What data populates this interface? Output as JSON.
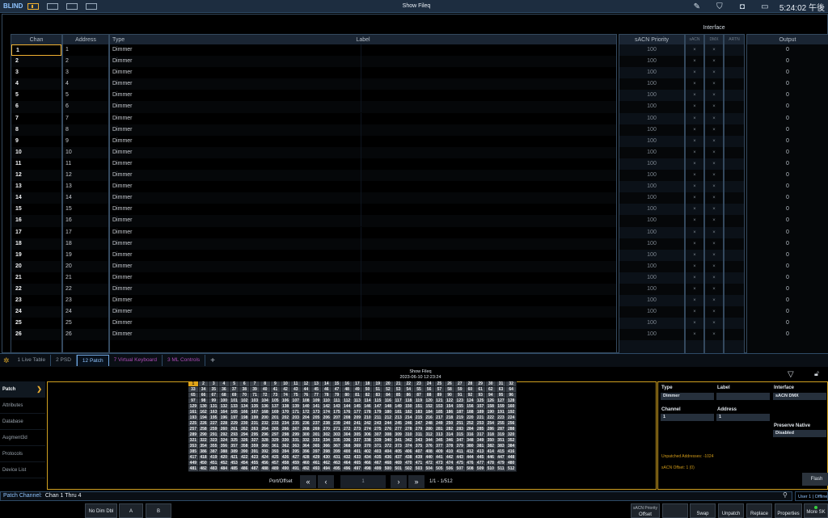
{
  "topbar": {
    "mode": "BLIND",
    "show_title": "Show Fileq",
    "clock": "5:24:02 午後"
  },
  "table": {
    "interface_title": "Interface",
    "headers": {
      "chan": "Chan",
      "address": "Address",
      "type": "Type",
      "label": "Label",
      "sacn_priority": "sACN Priority",
      "sacn": "sACN",
      "dmx": "DMX",
      "artnet": "ARTN",
      "output": "Output"
    },
    "rows": [
      {
        "chan": "1",
        "address": "1",
        "type": "Dimmer",
        "priority": "100",
        "sacn": "×",
        "dmx": "×",
        "output": "0"
      },
      {
        "chan": "2",
        "address": "2",
        "type": "Dimmer",
        "priority": "100",
        "sacn": "×",
        "dmx": "×",
        "output": "0"
      },
      {
        "chan": "3",
        "address": "3",
        "type": "Dimmer",
        "priority": "100",
        "sacn": "×",
        "dmx": "×",
        "output": "0"
      },
      {
        "chan": "4",
        "address": "4",
        "type": "Dimmer",
        "priority": "100",
        "sacn": "×",
        "dmx": "×",
        "output": "0"
      },
      {
        "chan": "5",
        "address": "5",
        "type": "Dimmer",
        "priority": "100",
        "sacn": "×",
        "dmx": "×",
        "output": "0"
      },
      {
        "chan": "6",
        "address": "6",
        "type": "Dimmer",
        "priority": "100",
        "sacn": "×",
        "dmx": "×",
        "output": "0"
      },
      {
        "chan": "7",
        "address": "7",
        "type": "Dimmer",
        "priority": "100",
        "sacn": "×",
        "dmx": "×",
        "output": "0"
      },
      {
        "chan": "8",
        "address": "8",
        "type": "Dimmer",
        "priority": "100",
        "sacn": "×",
        "dmx": "×",
        "output": "0"
      },
      {
        "chan": "9",
        "address": "9",
        "type": "Dimmer",
        "priority": "100",
        "sacn": "×",
        "dmx": "×",
        "output": "0"
      },
      {
        "chan": "10",
        "address": "10",
        "type": "Dimmer",
        "priority": "100",
        "sacn": "×",
        "dmx": "×",
        "output": "0"
      },
      {
        "chan": "11",
        "address": "11",
        "type": "Dimmer",
        "priority": "100",
        "sacn": "×",
        "dmx": "×",
        "output": "0"
      },
      {
        "chan": "12",
        "address": "12",
        "type": "Dimmer",
        "priority": "100",
        "sacn": "×",
        "dmx": "×",
        "output": "0"
      },
      {
        "chan": "13",
        "address": "13",
        "type": "Dimmer",
        "priority": "100",
        "sacn": "×",
        "dmx": "×",
        "output": "0"
      },
      {
        "chan": "14",
        "address": "14",
        "type": "Dimmer",
        "priority": "100",
        "sacn": "×",
        "dmx": "×",
        "output": "0"
      },
      {
        "chan": "15",
        "address": "15",
        "type": "Dimmer",
        "priority": "100",
        "sacn": "×",
        "dmx": "×",
        "output": "0"
      },
      {
        "chan": "16",
        "address": "16",
        "type": "Dimmer",
        "priority": "100",
        "sacn": "×",
        "dmx": "×",
        "output": "0"
      },
      {
        "chan": "17",
        "address": "17",
        "type": "Dimmer",
        "priority": "100",
        "sacn": "×",
        "dmx": "×",
        "output": "0"
      },
      {
        "chan": "18",
        "address": "18",
        "type": "Dimmer",
        "priority": "100",
        "sacn": "×",
        "dmx": "×",
        "output": "0"
      },
      {
        "chan": "19",
        "address": "19",
        "type": "Dimmer",
        "priority": "100",
        "sacn": "×",
        "dmx": "×",
        "output": "0"
      },
      {
        "chan": "20",
        "address": "20",
        "type": "Dimmer",
        "priority": "100",
        "sacn": "×",
        "dmx": "×",
        "output": "0"
      },
      {
        "chan": "21",
        "address": "21",
        "type": "Dimmer",
        "priority": "100",
        "sacn": "×",
        "dmx": "×",
        "output": "0"
      },
      {
        "chan": "22",
        "address": "22",
        "type": "Dimmer",
        "priority": "100",
        "sacn": "×",
        "dmx": "×",
        "output": "0"
      },
      {
        "chan": "23",
        "address": "23",
        "type": "Dimmer",
        "priority": "100",
        "sacn": "×",
        "dmx": "×",
        "output": "0"
      },
      {
        "chan": "24",
        "address": "24",
        "type": "Dimmer",
        "priority": "100",
        "sacn": "×",
        "dmx": "×",
        "output": "0"
      },
      {
        "chan": "25",
        "address": "25",
        "type": "Dimmer",
        "priority": "100",
        "sacn": "×",
        "dmx": "×",
        "output": "0"
      },
      {
        "chan": "26",
        "address": "26",
        "type": "Dimmer",
        "priority": "100",
        "sacn": "×",
        "dmx": "×",
        "output": "0"
      }
    ]
  },
  "tabs": [
    {
      "label": "1 Live Table",
      "state": "normal"
    },
    {
      "label": "2 PSD",
      "state": "normal"
    },
    {
      "label": "12 Patch",
      "state": "active"
    },
    {
      "label": "7 Virtual Keyboard",
      "state": "purple"
    },
    {
      "label": "3 ML Controls",
      "state": "purple"
    }
  ],
  "patch": {
    "show_name": "Show Fileq",
    "show_date": "2023-06-10 12:23:24",
    "sidebar": [
      "Patch",
      "Attributes",
      "Database",
      "Augment3d",
      "Protocols",
      "Device List"
    ],
    "address_count": 512,
    "selected_address": 1,
    "pager": {
      "port_offset_label": "Port/Offset",
      "page_value": "1",
      "range": "1/1 - 1/512"
    }
  },
  "properties": {
    "type_label": "Type",
    "type_value": "Dimmer",
    "label_label": "Label",
    "label_value": "",
    "interface_label": "Interface",
    "interface_value": "sACN DMX",
    "channel_label": "Channel",
    "channel_value": "1",
    "address_label": "Address",
    "address_value": "1",
    "preserve_label": "Preserve Native",
    "preserve_value": "Disabled",
    "unpatched_note": "Unpatched Addresses: -1024",
    "offset_note": "sACN Offset: 1 (0)",
    "flash_label": "Flash"
  },
  "command_line": {
    "prompt": "Patch Channel:",
    "value": "Chan 1 Thru 4",
    "user_status": "User 1 | Offline"
  },
  "softkeys": {
    "no_dim_dbl": "No Dim Dbl",
    "a": "A",
    "b": "B",
    "offset_top": "sACN Priority",
    "offset": "Offset",
    "swap": "Swap",
    "unpatch": "Unpatch",
    "replace": "Replace",
    "properties": "Properties",
    "more_sk": "More SK"
  },
  "colors": {
    "accent": "#f0b030",
    "tab_active": "#8fc4ff",
    "tab_purple": "#b04cb8",
    "border": "#34495e"
  }
}
